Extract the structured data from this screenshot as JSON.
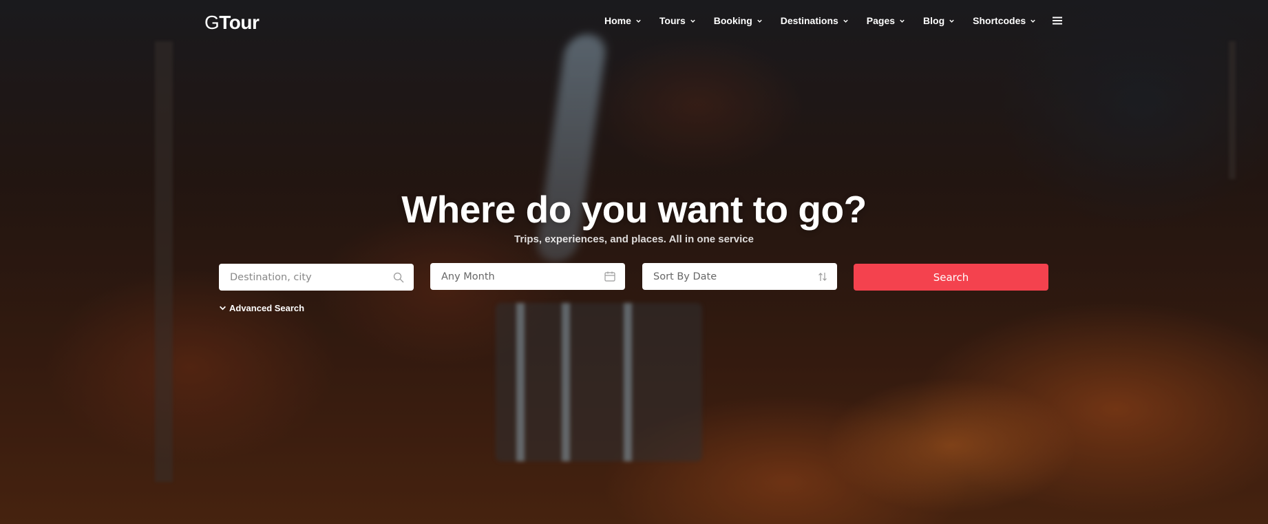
{
  "brand": {
    "logo": "GTour",
    "logo_g": "G",
    "logo_rest": "Tour"
  },
  "nav": {
    "items": [
      {
        "label": "Home"
      },
      {
        "label": "Tours"
      },
      {
        "label": "Booking"
      },
      {
        "label": "Destinations"
      },
      {
        "label": "Pages"
      },
      {
        "label": "Blog"
      },
      {
        "label": "Shortcodes"
      }
    ],
    "menu_icon": "hamburger-icon"
  },
  "hero": {
    "title": "Where do you want to go?",
    "subtitle": "Trips, experiences, and places. All in one service"
  },
  "search": {
    "destination_placeholder": "Destination, city",
    "destination_icon": "search-icon",
    "month_value": "Any Month",
    "month_icon": "calendar-icon",
    "sort_value": "Sort By Date",
    "sort_icon": "sort-arrows-icon",
    "button_label": "Search",
    "advanced_label": "Advanced Search",
    "advanced_icon": "chevron-down-icon"
  },
  "colors": {
    "accent": "#f4424e",
    "text": "#ffffff",
    "field_bg": "#ffffff"
  }
}
